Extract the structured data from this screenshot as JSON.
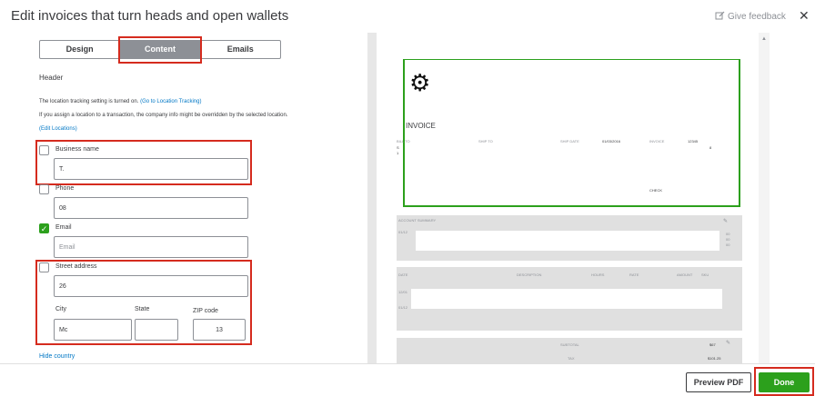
{
  "header": {
    "title": "Edit invoices that turn heads and open wallets",
    "feedback_label": "Give feedback",
    "close_glyph": "✕"
  },
  "tabs": [
    {
      "label": "Design"
    },
    {
      "label": "Content"
    },
    {
      "label": "Emails"
    }
  ],
  "form": {
    "section_title": "Header",
    "location_text": "The location tracking setting is turned on.",
    "location_link": "(Go to Location Tracking)",
    "assign_text": "If you assign a location to a transaction, the company info might be overridden by the selected location.",
    "edit_locations": "(Edit Locations)",
    "business_name_label": "Business name",
    "business_name_value": "T.",
    "phone_label": "Phone",
    "phone_value": "08",
    "email_label": "Email",
    "email_placeholder": "Email",
    "street_label": "Street address",
    "street_value": "26",
    "city_label": "City",
    "city_value": "Mc",
    "state_label": "State",
    "state_value": "",
    "zip_label": "ZIP code",
    "zip_value": "13",
    "hide_country": "Hide country"
  },
  "preview": {
    "invoice_title": "INVOICE",
    "bill_to": "BILL TO",
    "ship_to": "SHIP TO",
    "ship_date_label": "SHIP DATE",
    "ship_date_value": "01/03/2016",
    "invoice_label": "INVOICE",
    "invoice_value": "12345",
    "bill_line1": "S",
    "bill_line2": "1",
    "bill_right": "8",
    "check": "CHECK",
    "account_summary": "ACCOUNT SUMMARY",
    "acct_date": "01/12",
    "acct_vals": [
      "00",
      "00",
      "00"
    ],
    "date_col": "DATE",
    "description_col": "DESCRIPTION",
    "hours_col": "HOURS",
    "rate_col": "RATE",
    "amount_col": "AMOUNT",
    "sku_col": "SKU",
    "row1_date": "12/01",
    "row2_date": "01/12",
    "subtotal_label": "SUBTOTAL",
    "subtotal_value": "$67",
    "tax_label": "TAX",
    "tax_value": "$101.25"
  },
  "footer": {
    "preview_pdf": "Preview PDF",
    "done": "Done"
  },
  "colors": {
    "accent_green": "#2ca01c",
    "highlight_red": "#d52b1e",
    "link_blue": "#0077c5"
  }
}
